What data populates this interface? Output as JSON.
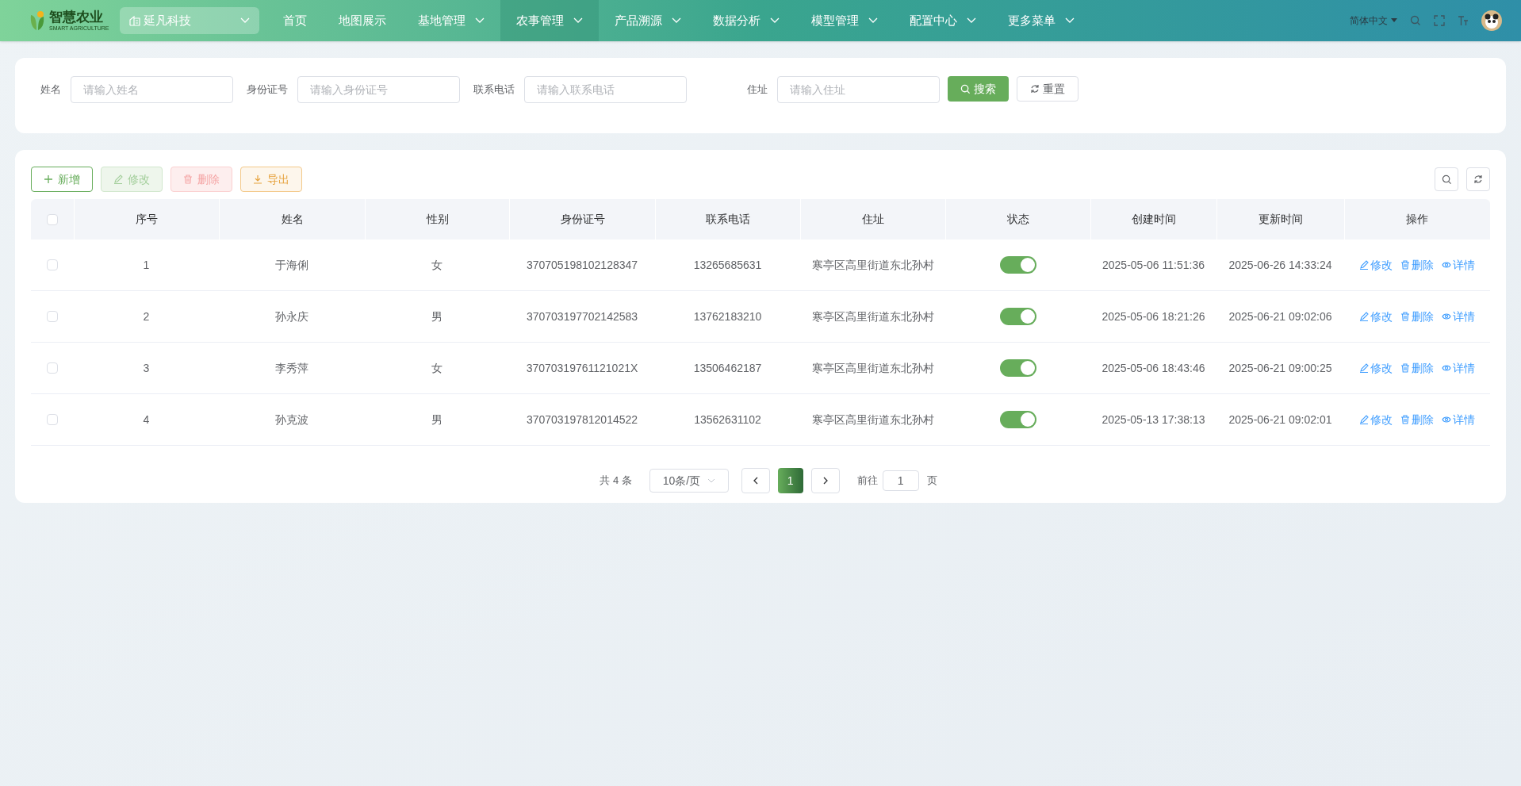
{
  "header": {
    "logo_title": "智慧农业",
    "logo_subtitle": "SMART AGRICULTURE",
    "org_select": "延凡科技",
    "nav": [
      {
        "label": "首页",
        "has_menu": false,
        "selected": false
      },
      {
        "label": "地图展示",
        "has_menu": false,
        "selected": false
      },
      {
        "label": "基地管理",
        "has_menu": true,
        "selected": false
      },
      {
        "label": "农事管理",
        "has_menu": true,
        "selected": true
      },
      {
        "label": "产品溯源",
        "has_menu": true,
        "selected": false
      },
      {
        "label": "数据分析",
        "has_menu": true,
        "selected": false
      },
      {
        "label": "模型管理",
        "has_menu": true,
        "selected": false
      },
      {
        "label": "配置中心",
        "has_menu": true,
        "selected": false
      },
      {
        "label": "更多菜单",
        "has_menu": true,
        "selected": false
      }
    ],
    "language": "简体中文"
  },
  "search": {
    "fields": [
      {
        "label": "姓名",
        "placeholder": "请输入姓名"
      },
      {
        "label": "身份证号",
        "placeholder": "请输入身份证号"
      },
      {
        "label": "联系电话",
        "placeholder": "请输入联系电话"
      },
      {
        "label": "住址",
        "placeholder": "请输入住址"
      }
    ],
    "search_button": "搜索",
    "reset_button": "重置"
  },
  "toolbar": [
    {
      "kind": "add",
      "label": "新增",
      "disabled": false
    },
    {
      "kind": "edit",
      "label": "修改",
      "disabled": true
    },
    {
      "kind": "delete",
      "label": "删除",
      "disabled": true
    },
    {
      "kind": "export",
      "label": "导出",
      "disabled": false
    }
  ],
  "table": {
    "select_all": false,
    "columns": [
      "序号",
      "姓名",
      "性别",
      "身份证号",
      "联系电话",
      "住址",
      "状态",
      "创建时间",
      "更新时间",
      "操作"
    ],
    "rows": [
      {
        "checked": false,
        "cells": [
          "1",
          "于海俐",
          "女",
          "370705198102128347",
          "13265685631",
          "寒亭区高里街道东北孙村"
        ],
        "on": true,
        "created": "2025-05-06 11:51:36",
        "updated": "2025-06-26 14:33:24",
        "actions": [
          "修改",
          "删除",
          "详情"
        ]
      },
      {
        "checked": false,
        "cells": [
          "2",
          "孙永庆",
          "男",
          "370703197702142583",
          "13762183210",
          "寒亭区高里街道东北孙村"
        ],
        "on": true,
        "created": "2025-05-06 18:21:26",
        "updated": "2025-06-21 09:02:06",
        "actions": [
          "修改",
          "删除",
          "详情"
        ]
      },
      {
        "checked": false,
        "cells": [
          "3",
          "李秀萍",
          "女",
          "37070319761121021X",
          "13506462187",
          "寒亭区高里街道东北孙村"
        ],
        "on": true,
        "created": "2025-05-06 18:43:46",
        "updated": "2025-06-21 09:00:25",
        "actions": [
          "修改",
          "删除",
          "详情"
        ]
      },
      {
        "checked": false,
        "cells": [
          "4",
          "孙克波",
          "男",
          "370703197812014522",
          "13562631102",
          "寒亭区高里街道东北孙村"
        ],
        "on": true,
        "created": "2025-05-13 17:38:13",
        "updated": "2025-06-21 09:02:01",
        "actions": [
          "修改",
          "删除",
          "详情"
        ]
      }
    ]
  },
  "pagination": {
    "total": "共 4 条",
    "page_size": "10条/页",
    "pages": [
      {
        "label": "1",
        "selected": true
      }
    ],
    "goto_label": "前往",
    "goto_value": "1",
    "goto_suffix": "页"
  }
}
